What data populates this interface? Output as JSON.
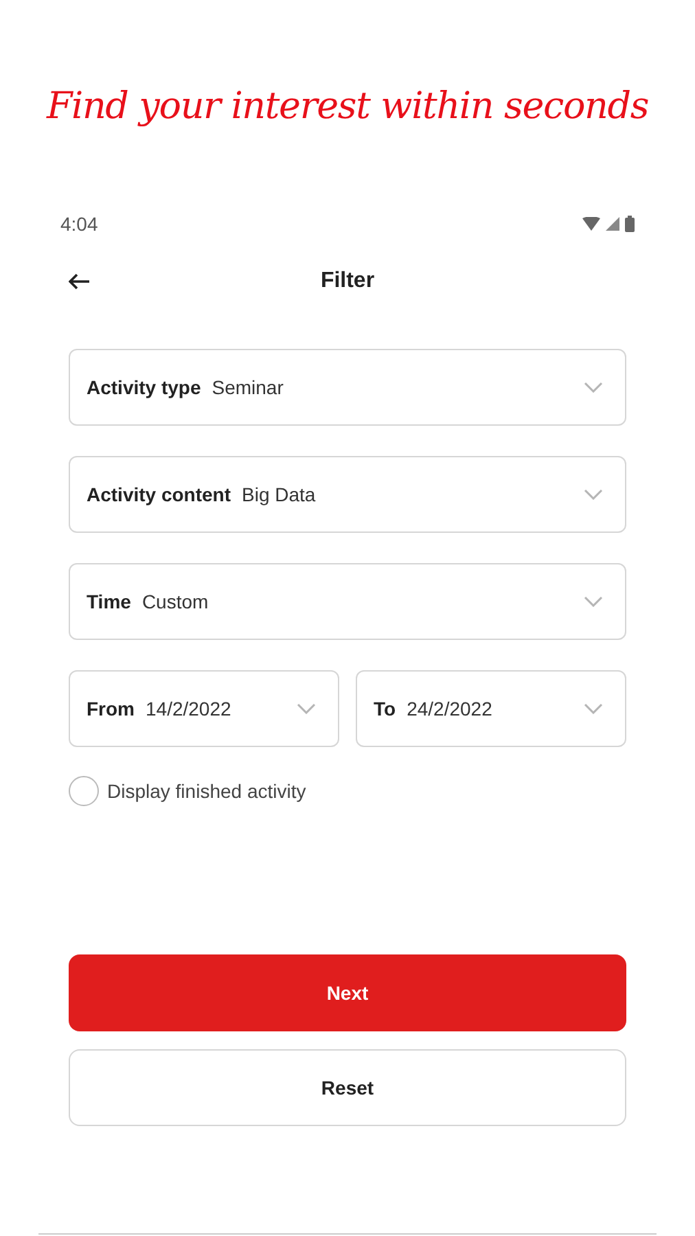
{
  "headline": "Find your interest within seconds",
  "status_bar": {
    "time": "4:04"
  },
  "header": {
    "title": "Filter"
  },
  "fields": [
    {
      "label": "Activity type",
      "value": "Seminar"
    },
    {
      "label": "Activity content",
      "value": "Big Data"
    },
    {
      "label": "Time",
      "value": "Custom"
    }
  ],
  "date_range": [
    {
      "label": "From",
      "value": "14/2/2022"
    },
    {
      "label": "To",
      "value": "24/2/2022"
    }
  ],
  "option": {
    "label": "Display finished activity",
    "checked": false
  },
  "buttons": [
    {
      "label": "Next",
      "kind": "primary"
    },
    {
      "label": "Reset",
      "kind": "secondary"
    }
  ]
}
